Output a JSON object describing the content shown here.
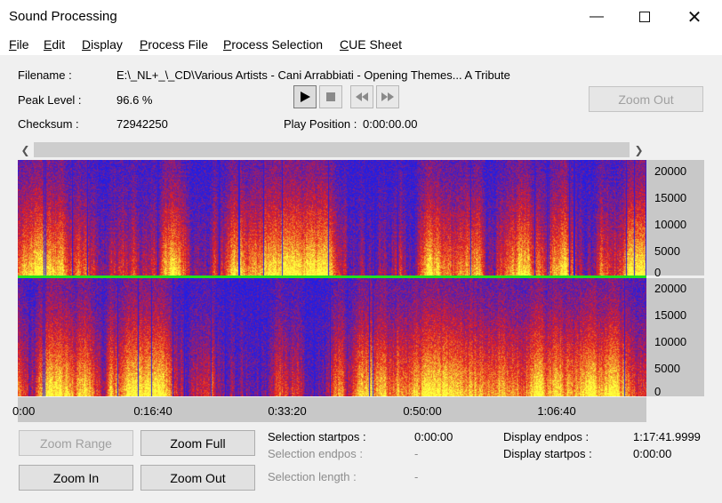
{
  "window": {
    "title": "Sound Processing"
  },
  "menu": [
    {
      "u": "F",
      "rest": "ile"
    },
    {
      "u": "E",
      "rest": "dit"
    },
    {
      "u": "D",
      "rest": "isplay"
    },
    {
      "u": "P",
      "rest": "rocess File"
    },
    {
      "u": "P",
      "rest": "rocess Selection"
    },
    {
      "u": "C",
      "rest": "UE Sheet"
    }
  ],
  "info": {
    "filename_label": "Filename :",
    "filename": "E:\\_NL+_\\_CD\\Various Artists - Cani Arrabbiati - Opening Themes... A Tribute",
    "peak_label": "Peak Level :",
    "peak": "96.6 %",
    "checksum_label": "Checksum :",
    "checksum": "72942250",
    "playpos_label": "Play Position :",
    "playpos": "0:00:00.00"
  },
  "transport": {
    "play_icon": "play-icon",
    "stop_icon": "stop-icon",
    "rewind_icon": "rewind-icon",
    "forward_icon": "fast-forward-icon"
  },
  "zoom_out_top": "Zoom Out",
  "freq_ticks": [
    "20000",
    "15000",
    "10000",
    "5000",
    "0"
  ],
  "time_ticks": [
    "0:00",
    "0:16:40",
    "0:33:20",
    "0:50:00",
    "1:06:40"
  ],
  "buttons": {
    "zoom_range": "Zoom Range",
    "zoom_full": "Zoom Full",
    "zoom_in": "Zoom In",
    "zoom_out": "Zoom Out"
  },
  "selection": {
    "start_label": "Selection startpos :",
    "start": "0:00:00",
    "end_label": "Selection endpos :",
    "end": "-",
    "length_label": "Selection length :",
    "length": "-"
  },
  "display": {
    "end_label": "Display endpos :",
    "end": "1:17:41.9999",
    "start_label": "Display startpos :",
    "start": "0:00:00"
  },
  "colors": {
    "spectrum_low": "#1e1ee6",
    "spectrum_mid": "#e61e1e",
    "spectrum_high": "#ffff3c",
    "channel_divider": "#20e020"
  }
}
